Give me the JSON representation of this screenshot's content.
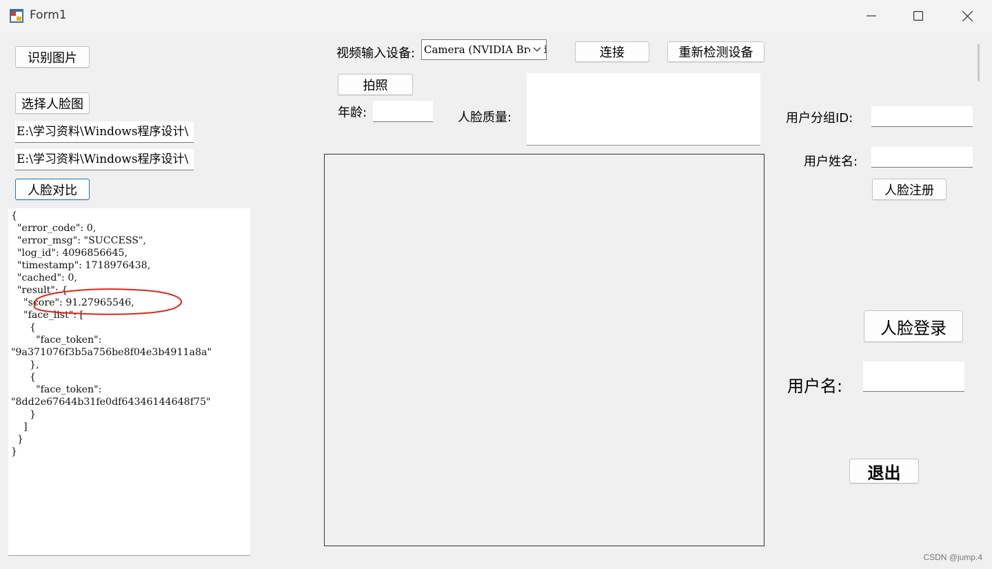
{
  "window": {
    "title": "Form1"
  },
  "buttons": {
    "recognize_image": "识别图片",
    "select_face_image": "选择人脸图",
    "face_compare": "人脸对比",
    "connect": "连接",
    "redetect_devices": "重新检测设备",
    "take_photo": "拍照",
    "face_register": "人脸注册",
    "face_login": "人脸登录",
    "exit": "退出"
  },
  "fields": {
    "image_path_1": "E:\\学习资料\\Windows程序设计\\",
    "image_path_2": "E:\\学习资料\\Windows程序设计\\",
    "age_value": "",
    "group_id_value": "",
    "user_name_value": "",
    "username_login_value": ""
  },
  "labels": {
    "video_device": "视频输入设备:",
    "age": "年龄:",
    "face_quality": "人脸质量:",
    "group_id": "用户分组ID:",
    "user_name": "用户姓名:",
    "username": "用户名:"
  },
  "device_combo": {
    "selected": "Camera (NVIDIA Broadcast)"
  },
  "result_json": "{\n  \"error_code\": 0,\n  \"error_msg\": \"SUCCESS\",\n  \"log_id\": 4096856645,\n  \"timestamp\": 1718976438,\n  \"cached\": 0,\n  \"result\": {\n    \"score\": 91.27965546,\n    \"face_list\": [\n      {\n        \"face_token\":\n\"9a371076f3b5a756be8f04e3b4911a8a\"\n      },\n      {\n        \"face_token\":\n\"8dd2e67644b31fe0df64346144648f75\"\n      }\n    ]\n  }\n}",
  "watermark": "CSDN @jump.4",
  "colors": {
    "annotation": "#e0241b",
    "focus_border": "#1a73c8",
    "background": "#f0f0f0"
  }
}
